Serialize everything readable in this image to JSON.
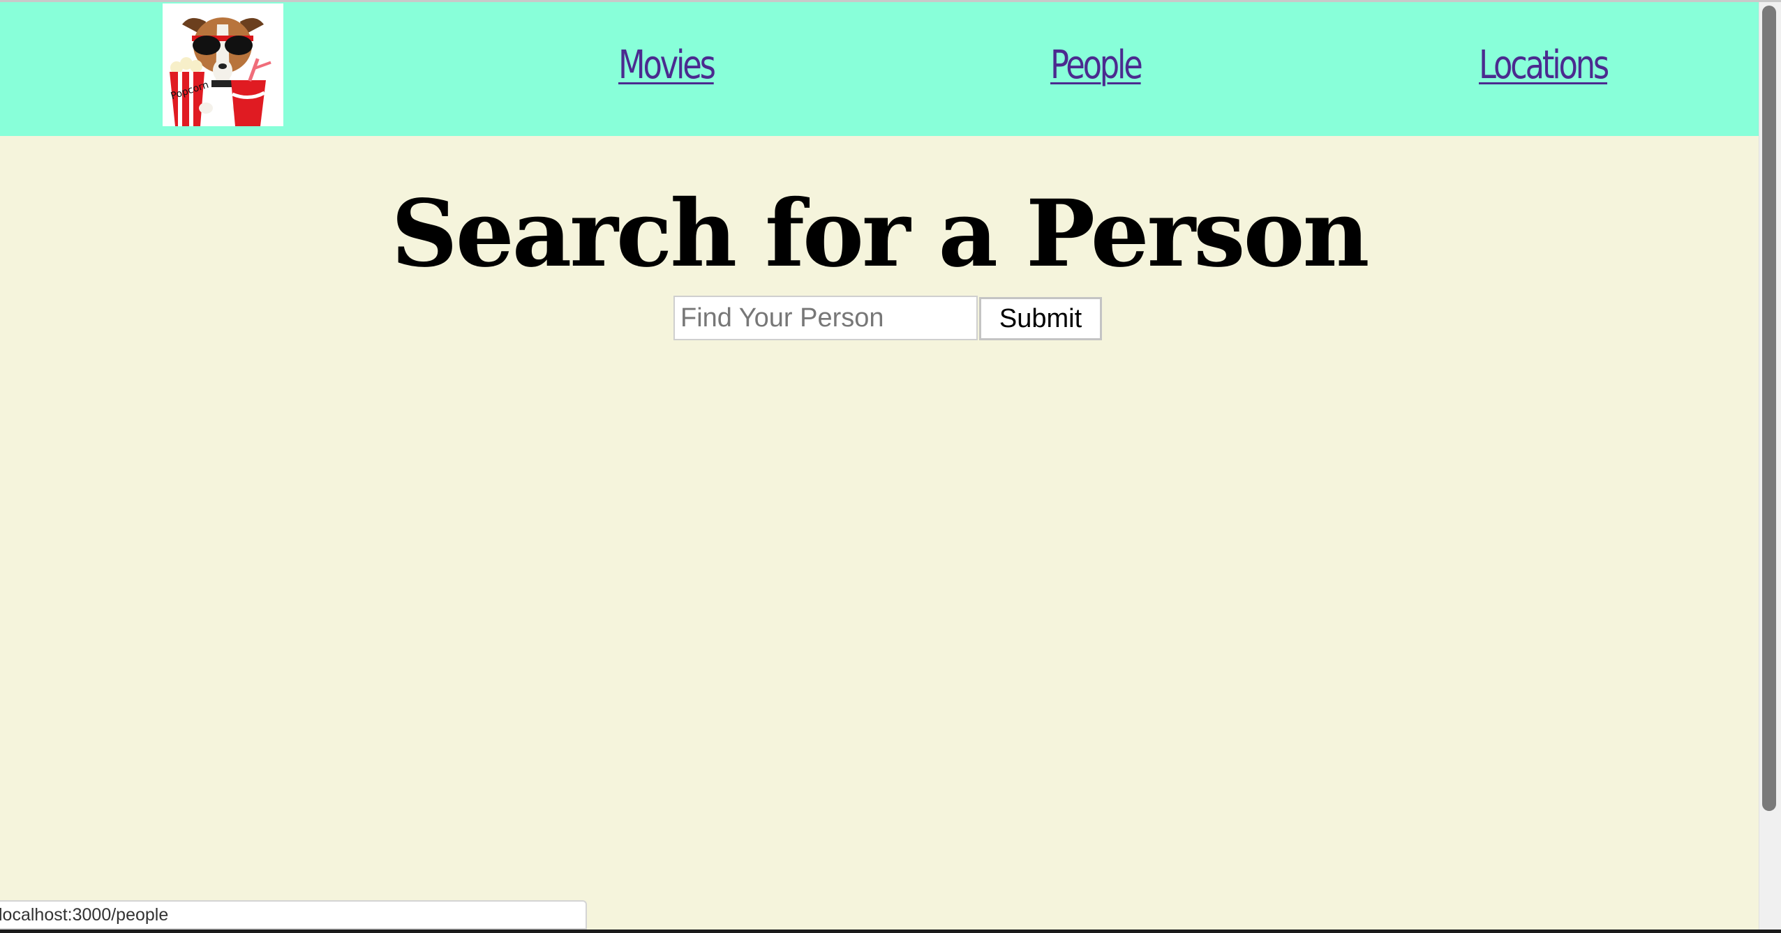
{
  "nav": {
    "logo_text": "Popcorn",
    "links": [
      {
        "label": "Movies"
      },
      {
        "label": "People"
      },
      {
        "label": "Locations"
      }
    ]
  },
  "main": {
    "title": "Search for a Person",
    "search": {
      "placeholder": "Find Your Person",
      "value": ""
    },
    "submit_label": "Submit"
  },
  "status_bar": {
    "url": "localhost:3000/people"
  },
  "colors": {
    "nav_background": "#88ffd9",
    "page_background": "#f5f4dc",
    "link": "#4b2a8f"
  }
}
